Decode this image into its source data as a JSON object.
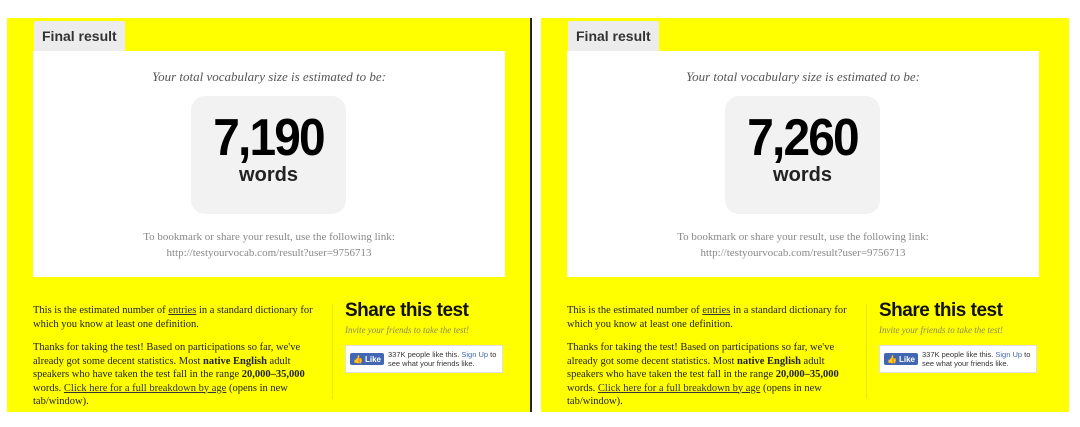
{
  "panels": [
    {
      "tab_label": "Final result",
      "subtitle": "Your total vocabulary size is estimated to be:",
      "score": "7,190",
      "unit": "words",
      "bookmark_line1": "To bookmark or share your result, use the following link:",
      "bookmark_link": "http://testyourvocab.com/result?user=9756713",
      "explain_p1_a": "This is the estimated number of ",
      "explain_p1_link": "entries",
      "explain_p1_b": " in a standard dictionary for which you know at least one definition.",
      "explain_p2_a": "Thanks for taking the test! Based on participations so far, we've already got some decent statistics. Most ",
      "explain_p2_bold1": "native English",
      "explain_p2_b": " adult speakers who have taken the test fall in the range ",
      "explain_p2_bold2": "20,000–35,000",
      "explain_p2_c": " words. ",
      "explain_p2_link": "Click here for a full breakdown by age",
      "explain_p2_d": " (opens in new tab/window).",
      "share_title": "Share this test",
      "share_sub": "Invite your friends to take the test!",
      "fb_like": "Like",
      "fb_count": "337K people like this.",
      "fb_signup": "Sign Up",
      "fb_tail": "to see what your friends like."
    },
    {
      "tab_label": "Final result",
      "subtitle": "Your total vocabulary size is estimated to be:",
      "score": "7,260",
      "unit": "words",
      "bookmark_line1": "To bookmark or share your result, use the following link:",
      "bookmark_link": "http://testyourvocab.com/result?user=9756713",
      "explain_p1_a": "This is the estimated number of ",
      "explain_p1_link": "entries",
      "explain_p1_b": " in a standard dictionary for which you know at least one definition.",
      "explain_p2_a": "Thanks for taking the test! Based on participations so far, we've already got some decent statistics. Most ",
      "explain_p2_bold1": "native English",
      "explain_p2_b": " adult speakers who have taken the test fall in the range ",
      "explain_p2_bold2": "20,000–35,000",
      "explain_p2_c": " words. ",
      "explain_p2_link": "Click here for a full breakdown by age",
      "explain_p2_d": " (opens in new tab/window).",
      "share_title": "Share this test",
      "share_sub": "Invite your friends to take the test!",
      "fb_like": "Like",
      "fb_count": "337K people like this.",
      "fb_signup": "Sign Up",
      "fb_tail": "to see what your friends like."
    }
  ],
  "colors": {
    "page_background": "#ffff00",
    "card_background": "#ffffff",
    "score_box": "#f2f2f2",
    "facebook_blue": "#4267b2"
  }
}
